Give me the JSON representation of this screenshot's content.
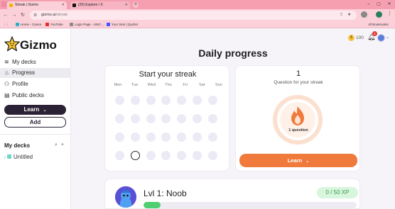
{
  "browser": {
    "tabs": [
      {
        "title": "Streak | Gizmo",
        "active": true,
        "favicon_color": "#f5b400"
      },
      {
        "title": "(20) Explore / X",
        "active": false,
        "favicon_color": "#111111"
      }
    ],
    "url_host": "gizmo.ai",
    "url_path": "/streak",
    "bookmarks": [
      {
        "label": "Home - Canva",
        "color": "#26b3c9"
      },
      {
        "label": "YouTube",
        "color": "#e52d27"
      },
      {
        "label": "Login Page - UNO ...",
        "color": "#8a8a8a"
      },
      {
        "label": "Your Sets | Quizlet",
        "color": "#4255ff"
      }
    ],
    "all_bookmarks_label": "All Bookmarks"
  },
  "sidebar": {
    "logo_text": "Gizmo",
    "nav": [
      {
        "label": "My decks",
        "icon": "layers-icon",
        "active": false
      },
      {
        "label": "Progress",
        "icon": "flame-icon",
        "active": true
      },
      {
        "label": "Profile",
        "icon": "user-icon",
        "active": false
      },
      {
        "label": "Public decks",
        "icon": "book-icon",
        "active": false
      }
    ],
    "learn_label": "Learn",
    "add_label": "Add",
    "decks_heading": "My decks",
    "decks": [
      {
        "label": "Untitled",
        "color": "#6bd6c9"
      }
    ]
  },
  "header": {
    "coins": "100",
    "notifications": "1"
  },
  "page_title": "Daily progress",
  "streak": {
    "title": "Start your streak",
    "days": [
      "Mon",
      "Tue",
      "Wed",
      "Thu",
      "Fri",
      "Sat",
      "Sun"
    ],
    "today_index": 1
  },
  "goal": {
    "count": "1",
    "label": "Question for your streak",
    "ring_caption": "1 question",
    "learn_label": "Learn",
    "progress_fraction": 0,
    "accent": "#f07a3c"
  },
  "level": {
    "title": "Lvl 1: Noob",
    "xp_text": "0 / 50 XP",
    "xp_fraction": 0.08
  }
}
